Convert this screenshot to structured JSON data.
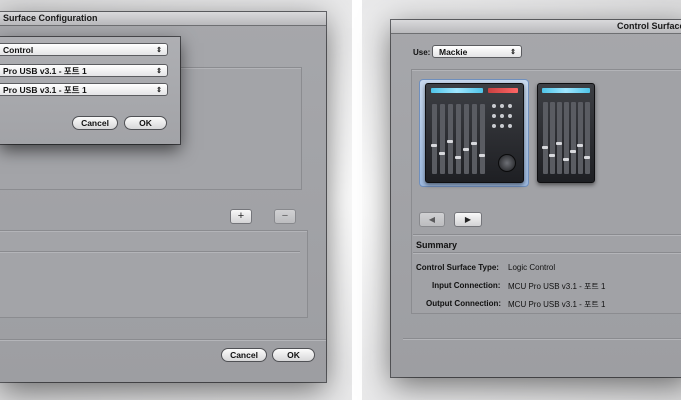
{
  "left_window": {
    "title": "Surface Configuration",
    "popups": [
      "Control",
      "Pro USB v3.1 - 포트 1",
      "Pro USB v3.1 - 포트 1"
    ],
    "dialog_cancel": "Cancel",
    "dialog_ok": "OK",
    "add_symbol": "+",
    "remove_symbol": "−",
    "cancel": "Cancel",
    "ok": "OK"
  },
  "right_window": {
    "title": "Control Surface",
    "use_label": "Use:",
    "use_value": "Mackie",
    "prev_symbol": "◀",
    "next_symbol": "▶",
    "summary_heading": "Summary",
    "fields": [
      {
        "label": "Control Surface Type:",
        "value": "Logic Control"
      },
      {
        "label": "Input Connection:",
        "value": "MCU Pro USB v3.1 - 포트 1"
      },
      {
        "label": "Output Connection:",
        "value": "MCU Pro USB v3.1 - 포트 1"
      }
    ]
  },
  "icons": {
    "popup_arrows": "⇕"
  }
}
